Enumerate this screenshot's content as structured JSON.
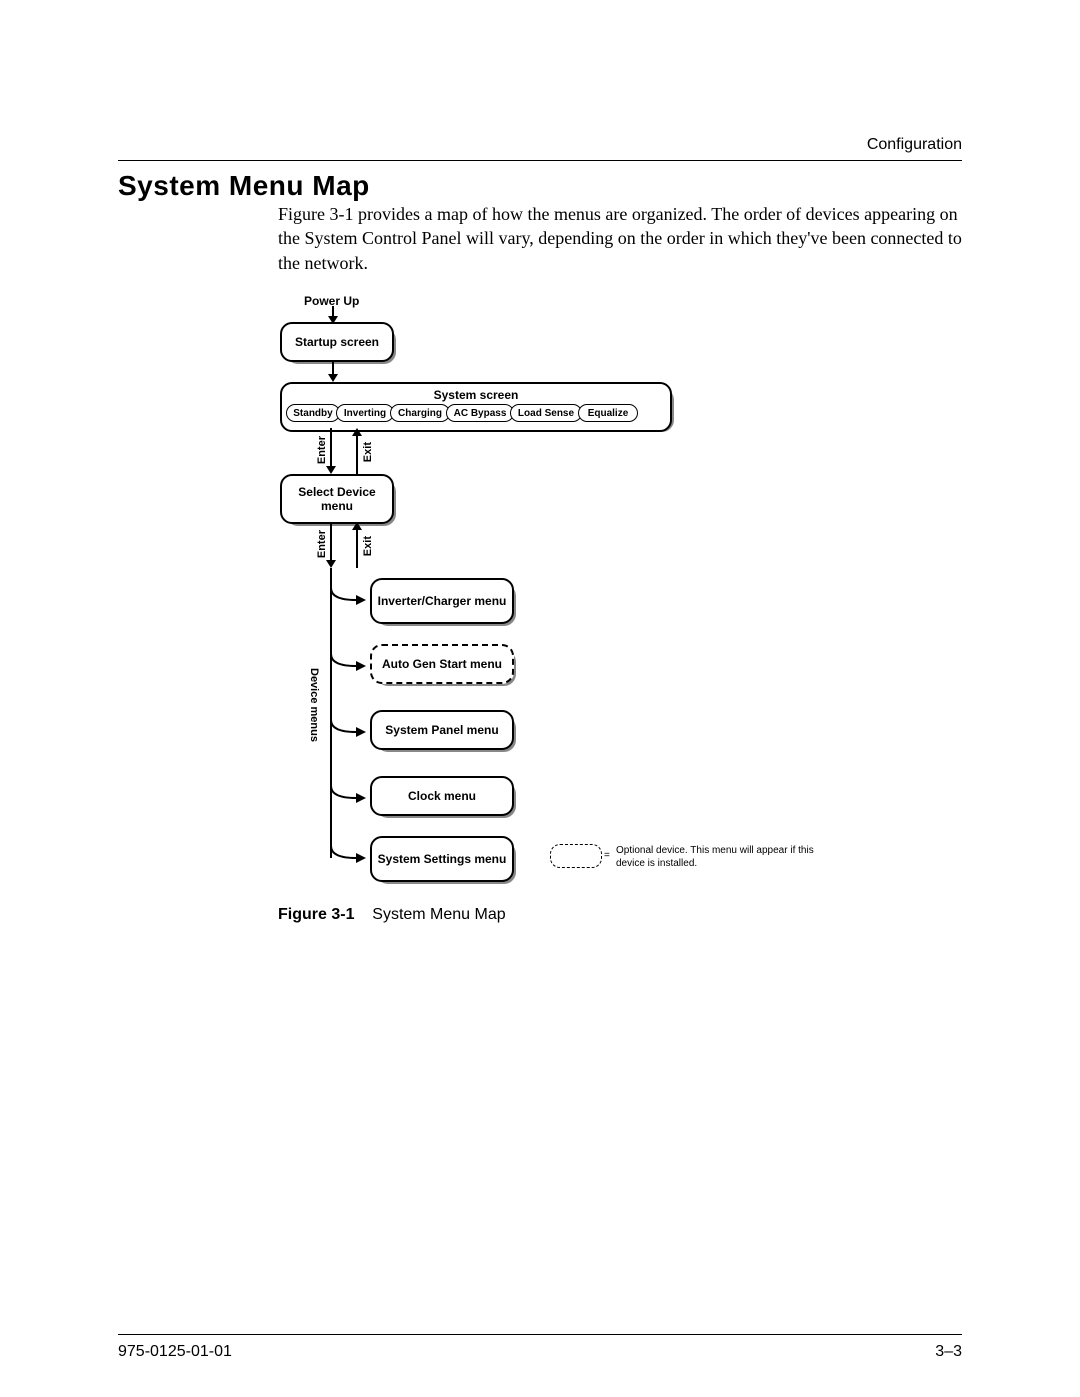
{
  "header": {
    "section_label": "Configuration",
    "title": "System Menu Map",
    "intro": "Figure 3-1 provides a map of how the menus are organized. The order of devices appearing on the System Control Panel will vary, depending on the order in which they've been connected to the network."
  },
  "diagram": {
    "power_up_label": "Power Up",
    "startup_screen": "Startup screen",
    "system_screen": {
      "title": "System screen",
      "modes": [
        "Standby",
        "Inverting",
        "Charging",
        "AC Bypass",
        "Load Sense",
        "Equalize"
      ]
    },
    "enter_label": "Enter",
    "exit_label": "Exit",
    "select_device_menu": "Select Device menu",
    "enter_label2": "Enter",
    "exit_label2": "Exit",
    "device_menus_label": "Device menus",
    "items": {
      "inverter_charger": "Inverter/Charger menu",
      "auto_gen_start": "Auto Gen Start menu",
      "system_panel": "System Panel menu",
      "clock": "Clock menu",
      "system_settings": "System Settings menu"
    },
    "legend": {
      "eq": "=",
      "text": "Optional device. This menu will appear if this device is installed."
    }
  },
  "caption": {
    "label": "Figure 3-1",
    "text": "System Menu Map"
  },
  "footer": {
    "doc_number": "975-0125-01-01",
    "page": "3–3"
  }
}
